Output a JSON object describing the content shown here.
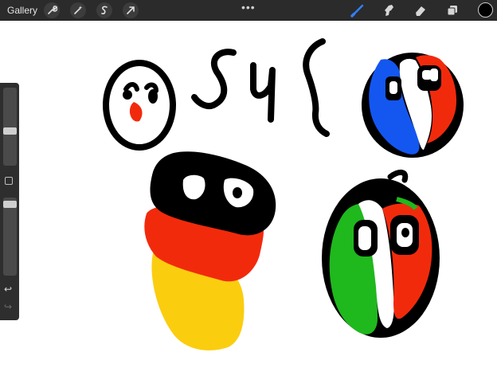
{
  "toolbar": {
    "gallery_label": "Gallery",
    "left_tools": [
      "wrench-icon",
      "magic-wand-icon",
      "selection-icon",
      "transform-arrow-icon"
    ],
    "menu_dots": "•••",
    "right_tools": [
      "brush-icon",
      "smudge-icon",
      "eraser-icon",
      "layers-icon"
    ],
    "active_tool": "brush-icon",
    "active_color": "#000000"
  },
  "sidebar": {
    "brush_size_level": 0.22,
    "opacity_level": 0.05,
    "undo_symbol": "↩",
    "redo_symbol": "↪"
  },
  "canvas": {
    "colors": {
      "black": "#000000",
      "red": "#f22a0c",
      "blue": "#1357f0",
      "yellow": "#fbcd0f",
      "green": "#1fb81d",
      "white": "#ffffff"
    },
    "drawings": [
      "generic-ball-drawing",
      "scribbled-text-drawing",
      "france-ball-drawing",
      "germany-ball-drawing",
      "italy-ball-drawing"
    ]
  }
}
